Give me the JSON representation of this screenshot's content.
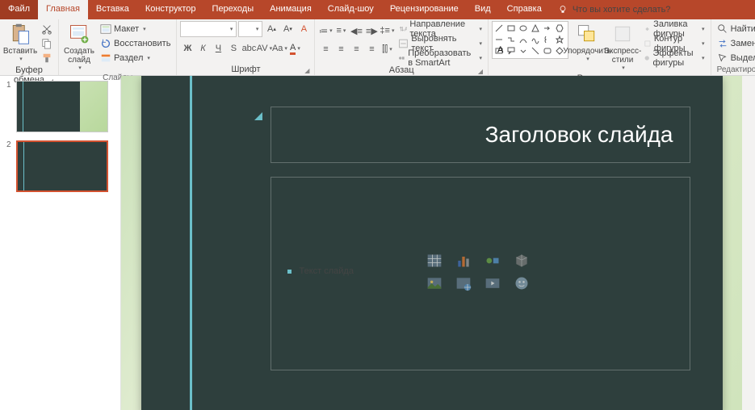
{
  "tabs": {
    "file": "Файл",
    "home": "Главная",
    "insert": "Вставка",
    "design": "Конструктор",
    "transitions": "Переходы",
    "animations": "Анимация",
    "slideshow": "Слайд-шоу",
    "review": "Рецензирование",
    "view": "Вид",
    "help": "Справка",
    "tellme": "Что вы хотите сделать?"
  },
  "ribbon": {
    "clipboard": {
      "paste": "Вставить",
      "label": "Буфер обмена"
    },
    "slides": {
      "new": "Создать\nслайд",
      "layout": "Макет",
      "reset": "Восстановить",
      "section": "Раздел",
      "label": "Слайды"
    },
    "font": {
      "label": "Шрифт"
    },
    "paragraph": {
      "dir": "Направление текста",
      "align": "Выровнять текст",
      "smartart": "Преобразовать в SmartArt",
      "label": "Абзац"
    },
    "drawing": {
      "arrange": "Упорядочить",
      "quick": "Экспресс-\nстили",
      "fill": "Заливка фигуры",
      "outline": "Контур фигуры",
      "effects": "Эффекты фигуры",
      "label": "Рисование"
    },
    "editing": {
      "find": "Найти",
      "replace": "Заменить",
      "select": "Выделить",
      "label": "Редактирование"
    }
  },
  "thumbs": {
    "n1": "1",
    "n2": "2"
  },
  "slide": {
    "title": "Заголовок слайда",
    "body": "Текст слайда"
  }
}
